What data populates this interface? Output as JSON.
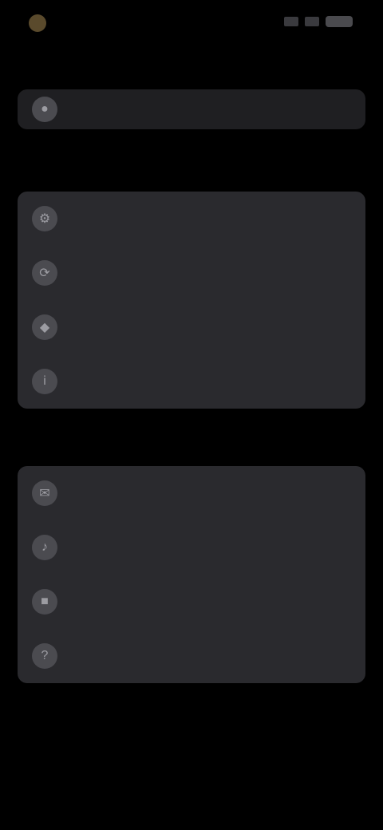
{
  "status": {
    "time": "",
    "icons": [
      "signal-icon",
      "wifi-icon",
      "battery-icon"
    ]
  },
  "header": {
    "title": ""
  },
  "top_card": {
    "label": "",
    "icon": "account-icon"
  },
  "sections": [
    {
      "label": "",
      "items": [
        {
          "label": "",
          "icon": "settings-icon"
        },
        {
          "label": "",
          "icon": "sync-icon"
        },
        {
          "label": "",
          "icon": "shield-icon"
        },
        {
          "label": "",
          "icon": "info-icon"
        }
      ]
    },
    {
      "label": "",
      "items": [
        {
          "label": "",
          "icon": "mail-icon"
        },
        {
          "label": "",
          "icon": "bell-icon"
        },
        {
          "label": "",
          "icon": "lock-icon"
        },
        {
          "label": "",
          "icon": "help-icon"
        }
      ]
    }
  ],
  "footer": {
    "text": ""
  },
  "colors": {
    "background": "#000000",
    "card": "#2a2a2e",
    "accent": "#5a4a2c"
  }
}
